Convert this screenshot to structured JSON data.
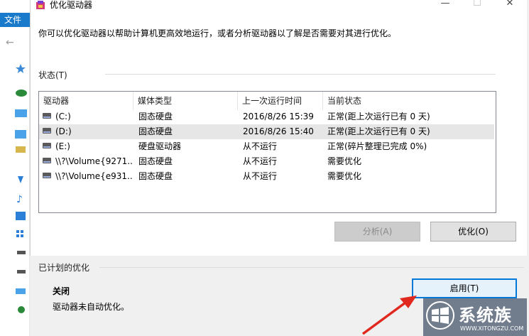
{
  "background_window": {
    "ribbon_tab": "文件",
    "back_arrow": "←"
  },
  "dialog": {
    "title": "优化驱动器",
    "controls": {
      "minimize": "—",
      "maximize": "☐",
      "close": "✕"
    },
    "description": "你可以优化驱动器以帮助计算机更高效地运行，或者分析驱动器以了解是否需要对其进行优化。",
    "status_label": "状态(T)",
    "columns": [
      "驱动器",
      "媒体类型",
      "上一次运行时间",
      "当前状态"
    ],
    "drives": [
      {
        "name": "(C:)",
        "media": "固态硬盘",
        "last_run": "2016/8/26 15:39",
        "status": "正常(距上次运行已有 0 天)",
        "selected": false
      },
      {
        "name": "(D:)",
        "media": "固态硬盘",
        "last_run": "2016/8/26 15:40",
        "status": "正常(距上次运行已有 0 天)",
        "selected": true
      },
      {
        "name": "(E:)",
        "media": "硬盘驱动器",
        "last_run": "从不运行",
        "status": "正常(碎片整理已完成 0%)",
        "selected": false
      },
      {
        "name": "\\\\?\\Volume{9271...",
        "media": "固态硬盘",
        "last_run": "从不运行",
        "status": "需要优化",
        "selected": false
      },
      {
        "name": "\\\\?\\Volume{e931...",
        "media": "固态硬盘",
        "last_run": "从不运行",
        "status": "需要优化",
        "selected": false
      }
    ],
    "analyze_button": "分析(A)",
    "optimize_button": "优化(O)",
    "scheduled_label": "已计划的优化",
    "scheduled_state": "关闭",
    "scheduled_desc": "驱动器未自动优化。",
    "enable_button": "启用(T)"
  },
  "watermark": {
    "text": "系统族",
    "url": "WWW.XITONGZU.COM"
  },
  "colors": {
    "accent": "#0078d7",
    "ribbon": "#1979ca",
    "annotation_arrow": "#e0281e",
    "selected_row": "#e6e6e6",
    "footer": "#f0f0f0"
  }
}
